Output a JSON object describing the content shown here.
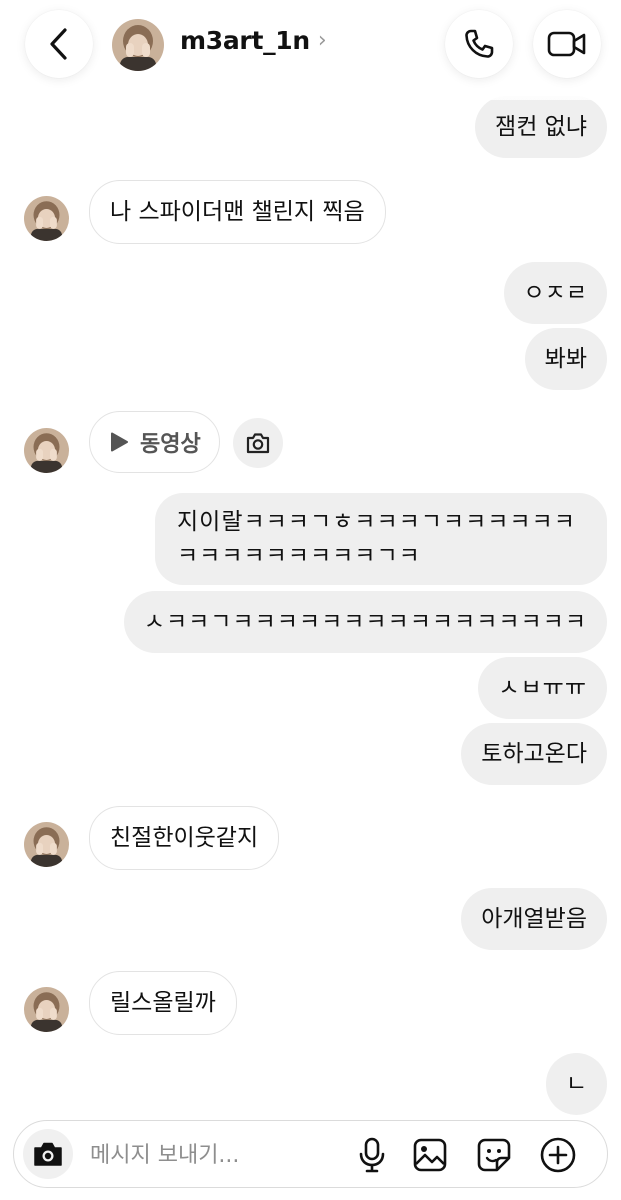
{
  "header": {
    "username": "m3art_1n",
    "chevron": "›",
    "back_icon": "chevron-left-icon",
    "call_icon": "phone-icon",
    "video_icon": "video-camera-icon"
  },
  "messages": {
    "m1": "잼컨 없냐",
    "m2": "나 스파이더맨 챌린지 찍음",
    "m3": "ㅇㅈㄹ",
    "m4": "봐봐",
    "m5": "동영상",
    "m6": "지이랄ㅋㅋㅋㄱㅎㅋㅋㅋㄱㅋㅋㅋㅋㅋㅋㅋㅋㅋㅋㅋㅋㅋㅋㅋㄱㅋ",
    "m7": "ㅅㅋㅋㄱㅋㅋㅋㅋㅋㅋㅋㅋㅋㅋㅋㅋㅋㅋㅋㅋ",
    "m8": "ㅅㅂㅠㅠ",
    "m9": "토하고온다",
    "m10": "친절한이웃같지",
    "m11": "아개열받음",
    "m12": "릴스올릴까",
    "m13": "ㄴ"
  },
  "composer": {
    "placeholder": "메시지 보내기...",
    "icons": [
      "camera-icon",
      "microphone-icon",
      "image-icon",
      "sticker-icon",
      "plus-circle-icon"
    ]
  },
  "colors": {
    "outgoing_bubble": "#efefef",
    "incoming_border": "#e3e3e3",
    "text": "#111111",
    "secondary": "#8e8e8e"
  }
}
